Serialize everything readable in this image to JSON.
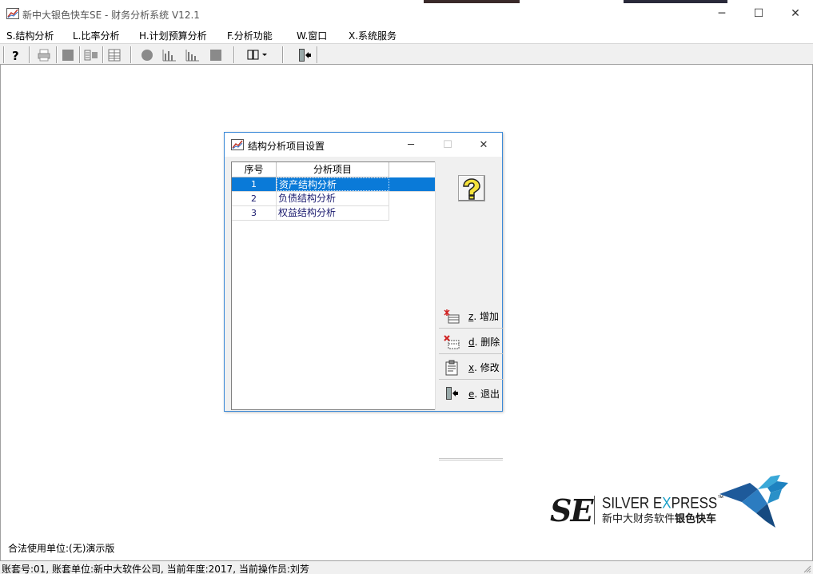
{
  "window": {
    "title": "新中大银色快车SE - 财务分析系统 V12.1",
    "minimize_glyph": "─",
    "maximize_glyph": "☐",
    "close_glyph": "✕"
  },
  "menubar": {
    "items": [
      {
        "label": "S.结构分析"
      },
      {
        "label": "L.比率分析"
      },
      {
        "label": "H.计划预算分析"
      },
      {
        "label": "F.分析功能"
      },
      {
        "label": "W.窗口"
      },
      {
        "label": "X.系统服务"
      }
    ]
  },
  "toolbar": {
    "icons": [
      "help-icon",
      "print-icon",
      "stop-icon",
      "export-icon",
      "table-icon",
      "circle-icon",
      "bar-chart-icon",
      "bar-chart-alt-icon",
      "square-icon",
      "columns-dropdown-icon",
      "exit-icon"
    ]
  },
  "dialog": {
    "title": "结构分析项目设置",
    "minimize_glyph": "─",
    "maximize_glyph": "☐",
    "close_glyph": "✕",
    "grid": {
      "columns": [
        "序号",
        "分析项目"
      ],
      "rows": [
        {
          "no": "1",
          "item": "资产结构分析",
          "selected": true
        },
        {
          "no": "2",
          "item": "负债结构分析",
          "selected": false
        },
        {
          "no": "3",
          "item": "权益结构分析",
          "selected": false
        }
      ]
    },
    "buttons": {
      "add": {
        "hotkey": "z",
        "label": "增加"
      },
      "delete": {
        "hotkey": "d",
        "label": "删除"
      },
      "edit": {
        "hotkey": "x",
        "label": "修改"
      },
      "exit": {
        "hotkey": "e",
        "label": "退出"
      }
    }
  },
  "logo": {
    "mark": "SE",
    "english_pre": "SILVER E",
    "english_x": "X",
    "english_post": "PRESS",
    "tm": "™",
    "chinese": "新中大财务软件",
    "chinese_bold": "银色快车"
  },
  "license": "合法使用单位:(无)演示版",
  "statusbar": {
    "text": "账套号:01, 账套单位:新中大软件公司, 当前年度:2017, 当前操作员:刘芳"
  },
  "colors": {
    "selection": "#0a7ad8",
    "dialog_border": "#3c8ad8",
    "accent_cyan": "#1aa0c8"
  }
}
